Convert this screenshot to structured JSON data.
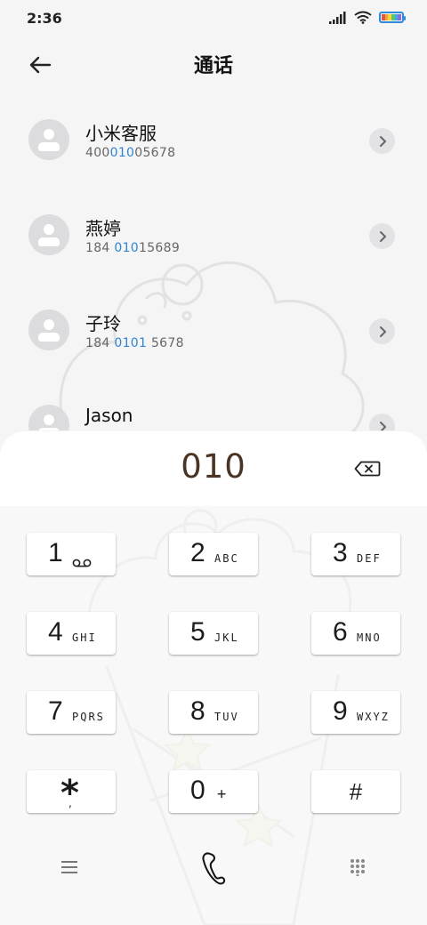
{
  "status_bar": {
    "time": "2:36",
    "battery_colors": [
      "#e5534b",
      "#f0a43a",
      "#f5d63c",
      "#5cc46b",
      "#41a8e6",
      "#8a6ce0"
    ]
  },
  "header": {
    "back_icon": "arrow-left-icon",
    "title": "通话"
  },
  "contacts": [
    {
      "name": "小米客服",
      "number_parts": [
        "400",
        "010",
        "05678"
      ]
    },
    {
      "name": "燕婷",
      "number_parts": [
        "184 ",
        "010",
        "15689"
      ]
    },
    {
      "name": "子玲",
      "number_parts": [
        "184 ",
        "0101",
        " 5678"
      ]
    },
    {
      "name": "Jason",
      "number_parts": [
        "",
        "",
        ""
      ]
    }
  ],
  "colors": {
    "highlight": "#2f84d6",
    "dial_text": "#4a3426"
  },
  "dialer": {
    "input_value": "010",
    "delete_icon": "backspace-icon",
    "keys": [
      {
        "digit": "1",
        "letters": ""
      },
      {
        "digit": "2",
        "letters": "ABC"
      },
      {
        "digit": "3",
        "letters": "DEF"
      },
      {
        "digit": "4",
        "letters": "GHI"
      },
      {
        "digit": "5",
        "letters": "JKL"
      },
      {
        "digit": "6",
        "letters": "MNO"
      },
      {
        "digit": "7",
        "letters": "PQRS"
      },
      {
        "digit": "8",
        "letters": "TUV"
      },
      {
        "digit": "9",
        "letters": "WXYZ"
      },
      {
        "digit": "*",
        "letters": ","
      },
      {
        "digit": "0",
        "letters": "+"
      },
      {
        "digit": "#",
        "letters": ""
      }
    ]
  },
  "bottom_bar": {
    "menu_icon": "menu-icon",
    "call_icon": "phone-call-icon",
    "keypad_icon": "keypad-grid-icon"
  }
}
